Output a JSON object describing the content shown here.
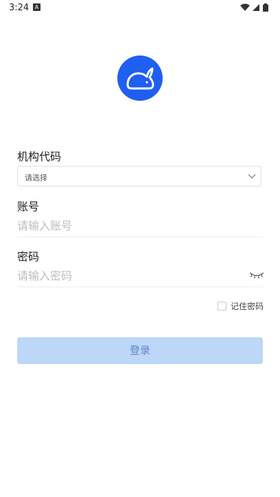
{
  "status_bar": {
    "time": "3:24",
    "notification_icon": "a-badge-icon",
    "wifi_icon": "wifi-icon",
    "signal_icon": "signal-icon",
    "battery_icon": "battery-icon"
  },
  "logo": {
    "icon": "rabbit-logo-icon",
    "color": "#1f5ff2"
  },
  "org_code": {
    "label": "机构代码",
    "selected_value": "请选择",
    "chevron": "chevron-down-icon"
  },
  "account": {
    "label": "账号",
    "placeholder": "请输入账号",
    "value": ""
  },
  "password": {
    "label": "密码",
    "placeholder": "请输入密码",
    "value": "",
    "visibility_icon": "eye-closed-icon"
  },
  "remember": {
    "label": "记住密码",
    "checked": false
  },
  "login_button": {
    "label": "登录",
    "background": "#bcd7f7",
    "text_color": "#5f86cf"
  }
}
